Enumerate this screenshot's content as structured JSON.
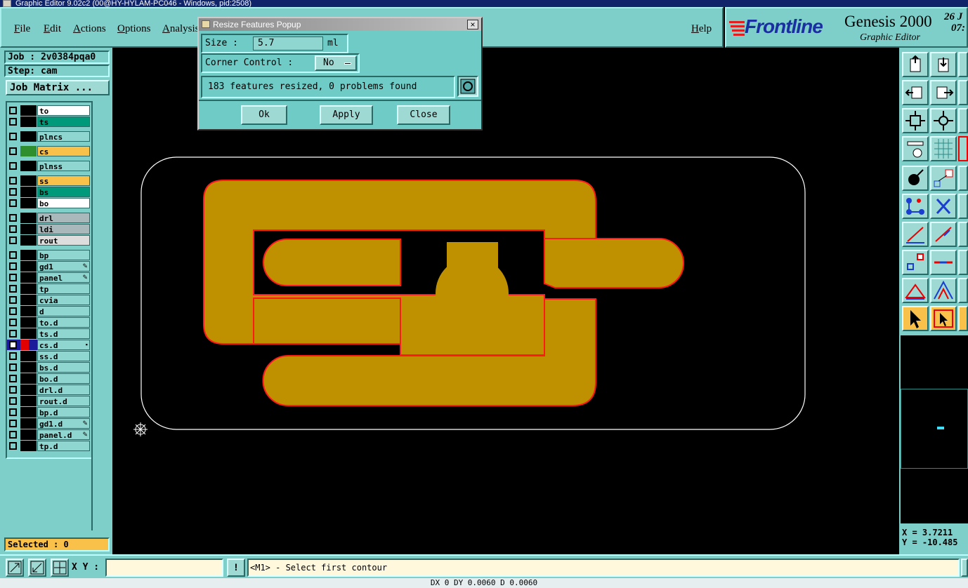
{
  "window": {
    "title": "Graphic Editor 9.02c2 (00@HY-HYLAM-PC046 - Windows, pid:2508)"
  },
  "menu": {
    "items": [
      "File",
      "Edit",
      "Actions",
      "Options",
      "Analysis"
    ],
    "help": "Help"
  },
  "logo": {
    "brand": "Frontline",
    "product": "Genesis 2000",
    "subtitle": "Graphic Editor",
    "date": "26 J",
    "time": "07:"
  },
  "job": {
    "label": "Job : 2v0384pqa0",
    "step": "Step: cam",
    "matrix_button": "Job Matrix ..."
  },
  "layers": [
    {
      "name": "to",
      "color": "#ffffff",
      "swatch": "#000000",
      "flag": ""
    },
    {
      "name": "ts",
      "color": "#009a7a",
      "swatch": "#000000",
      "flag": ""
    },
    {
      "name": "plncs",
      "color": "#8fd6d1",
      "swatch": "#000000",
      "flag": ""
    },
    {
      "name": "cs",
      "color": "#f9c04a",
      "swatch": "#2f8f2f",
      "flag": ""
    },
    {
      "name": "plnss",
      "color": "#8fd6d1",
      "swatch": "#000000",
      "flag": ""
    },
    {
      "name": "ss",
      "color": "#f9c04a",
      "swatch": "#000000",
      "flag": ""
    },
    {
      "name": "bs",
      "color": "#009a7a",
      "swatch": "#000000",
      "flag": ""
    },
    {
      "name": "bo",
      "color": "#ffffff",
      "swatch": "#000000",
      "flag": ""
    },
    {
      "name": "drl",
      "color": "#a9b9bb",
      "swatch": "#000000",
      "flag": ""
    },
    {
      "name": "ldi",
      "color": "#a9b9bb",
      "swatch": "#000000",
      "flag": ""
    },
    {
      "name": "rout",
      "color": "#dddddd",
      "swatch": "#000000",
      "flag": ""
    },
    {
      "name": "bp",
      "color": "#8fd6d1",
      "swatch": "#000000",
      "flag": ""
    },
    {
      "name": "gd1",
      "color": "#8fd6d1",
      "swatch": "#000000",
      "flag": "edit"
    },
    {
      "name": "panel",
      "color": "#8fd6d1",
      "swatch": "#000000",
      "flag": "edit"
    },
    {
      "name": "tp",
      "color": "#8fd6d1",
      "swatch": "#000000",
      "flag": ""
    },
    {
      "name": "cvia",
      "color": "#8fd6d1",
      "swatch": "#000000",
      "flag": ""
    },
    {
      "name": "d",
      "color": "#8fd6d1",
      "swatch": "#000000",
      "flag": ""
    },
    {
      "name": "to.d",
      "color": "#8fd6d1",
      "swatch": "#000000",
      "flag": ""
    },
    {
      "name": "ts.d",
      "color": "#8fd6d1",
      "swatch": "#000000",
      "flag": ""
    },
    {
      "name": "cs.d",
      "color": "#8fd6d1",
      "swatch": "#e00000",
      "flag": "work",
      "active": true
    },
    {
      "name": "ss.d",
      "color": "#8fd6d1",
      "swatch": "#000000",
      "flag": ""
    },
    {
      "name": "bs.d",
      "color": "#8fd6d1",
      "swatch": "#000000",
      "flag": ""
    },
    {
      "name": "bo.d",
      "color": "#8fd6d1",
      "swatch": "#000000",
      "flag": ""
    },
    {
      "name": "drl.d",
      "color": "#8fd6d1",
      "swatch": "#000000",
      "flag": ""
    },
    {
      "name": "rout.d",
      "color": "#8fd6d1",
      "swatch": "#000000",
      "flag": ""
    },
    {
      "name": "bp.d",
      "color": "#8fd6d1",
      "swatch": "#000000",
      "flag": ""
    },
    {
      "name": "gd1.d",
      "color": "#8fd6d1",
      "swatch": "#000000",
      "flag": "edit"
    },
    {
      "name": "panel.d",
      "color": "#8fd6d1",
      "swatch": "#000000",
      "flag": "edit"
    },
    {
      "name": "tp.d",
      "color": "#8fd6d1",
      "swatch": "#000000",
      "flag": ""
    }
  ],
  "selected": "Selected : 0",
  "popup": {
    "title": "Resize Features Popup",
    "size_label": "Size :",
    "size_value": "5.7",
    "size_unit": "ml",
    "corner_label": "Corner Control :",
    "corner_value": "No",
    "result": "183 features resized, 0 problems found",
    "ok": "Ok",
    "apply": "Apply",
    "close": "Close"
  },
  "coords": {
    "x": "X = 3.7211",
    "y": "Y = -10.485"
  },
  "status": {
    "xy_label": "X Y :",
    "xy_value": "",
    "alert": "!",
    "prompt": "<M1> - Select first contour",
    "bottom": "DX 0 DY 0.0060 D 0.0060"
  },
  "colors": {
    "feature_fill": "#bf9100",
    "feature_outline": "#ff1a1a",
    "profile": "#ffffff",
    "panel": "#7ecfca",
    "canvas": "#000000"
  }
}
